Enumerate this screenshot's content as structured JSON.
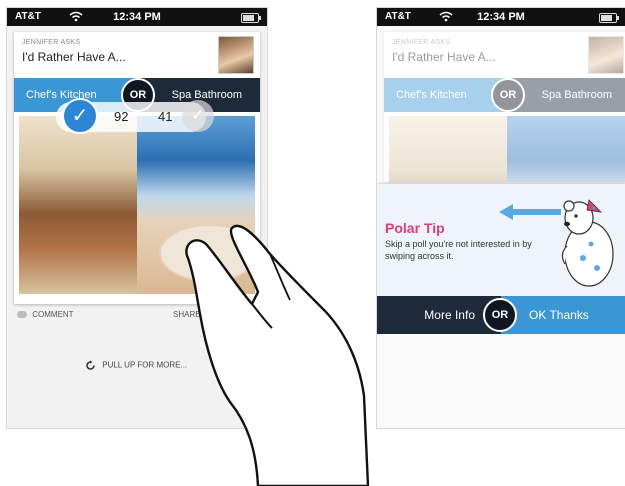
{
  "status_bar": {
    "carrier": "AT&T",
    "time": "12:34 PM"
  },
  "poll": {
    "asker": "JENNIFER ASKS",
    "question": "I'd Rather Have A...",
    "option_left": "Chef's Kitchen",
    "separator": "OR",
    "option_right": "Spa Bathroom",
    "votes_left": "92",
    "votes_right": "41"
  },
  "actions": {
    "comment": "COMMENT",
    "share": "SHARE",
    "pull": "PULL UP FOR MORE..."
  },
  "tip": {
    "title": "Polar Tip",
    "text": "Skip a poll you're not interested in by swiping across it.",
    "left_button": "More Info",
    "separator": "OR",
    "right_button": "OK Thanks"
  },
  "colors": {
    "accent_blue": "#3a97d4",
    "dark_navy": "#1d2a3a",
    "tip_pink": "#e23a7d"
  },
  "icons": [
    "wifi-icon",
    "battery-icon",
    "checkmark-icon",
    "comment-icon",
    "refresh-icon",
    "arrow-left-icon",
    "polar-bear-mascot",
    "hand-gesture"
  ]
}
